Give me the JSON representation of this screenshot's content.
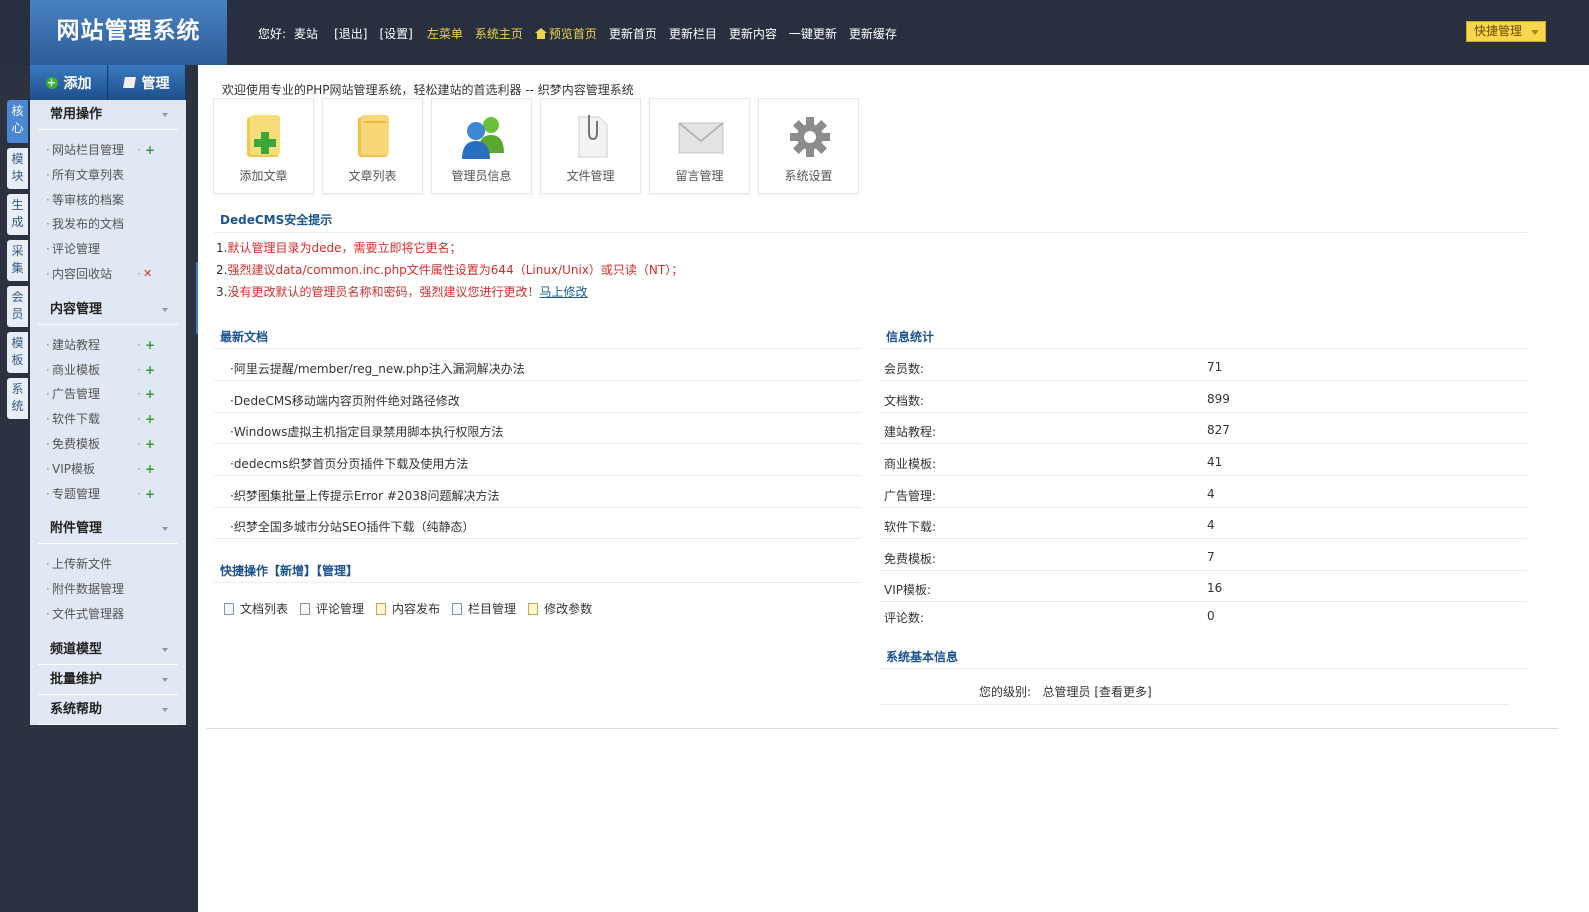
{
  "app": {
    "title": "网站管理系统"
  },
  "topnav": {
    "greeting": "您好:",
    "user": "麦站",
    "logout": "[退出]",
    "settings": "[设置]",
    "left_menu": "左菜单",
    "system_home": "系统主页",
    "preview_home": "预览首页",
    "links": [
      "更新首页",
      "更新栏目",
      "更新内容",
      "一键更新",
      "更新缓存"
    ],
    "quick_manage": "快捷管理"
  },
  "vtabs": [
    "核心",
    "模块",
    "生成",
    "采集",
    "会员",
    "模板",
    "系统"
  ],
  "sidebar": {
    "add_label": "添加",
    "manage_label": "管理",
    "groups": [
      {
        "title": "常用操作",
        "items": [
          "网站栏目管理",
          "所有文章列表",
          "等审核的档案",
          "我发布的文档",
          "评论管理",
          "内容回收站"
        ]
      },
      {
        "title": "内容管理",
        "items": [
          "建站教程",
          "商业模板",
          "广告管理",
          "软件下载",
          "免费模板",
          "VIP模板",
          "专题管理"
        ]
      },
      {
        "title": "附件管理",
        "items": [
          "上传新文件",
          "附件数据管理",
          "文件式管理器"
        ]
      },
      {
        "title": "频道模型",
        "items": []
      },
      {
        "title": "批量维护",
        "items": []
      },
      {
        "title": "系统帮助",
        "items": []
      }
    ]
  },
  "main": {
    "welcome": "欢迎使用专业的PHP网站管理系统，轻松建站的首选利器 -- 织梦内容管理系统",
    "tiles": [
      "添加文章",
      "文章列表",
      "管理员信息",
      "文件管理",
      "留言管理",
      "系统设置"
    ],
    "security": {
      "title": "DedeCMS安全提示",
      "lines": [
        {
          "num": "1.",
          "text": "默认管理目录为dede，需要立即将它更名；"
        },
        {
          "num": "2.",
          "text": "强烈建议data/common.inc.php文件属性设置为644（Linux/Unix）或只读（NT）；"
        },
        {
          "num": "3.",
          "text": "没有更改默认的管理员名称和密码，强烈建议您进行更改！",
          "link": "马上修改"
        }
      ]
    },
    "latest_docs": {
      "title": "最新文档",
      "items": [
        "·阿里云提醒/member/reg_new.php注入漏洞解决办法",
        "·DedeCMS移动端内容页附件绝对路径修改",
        "·Windows虚拟主机指定目录禁用脚本执行权限方法",
        "·dedecms织梦首页分页插件下载及使用方法",
        "·织梦图集批量上传提示Error #2038问题解决方法",
        "·织梦全国多城市分站SEO插件下载（纯静态）"
      ]
    },
    "stats": {
      "title": "信息统计",
      "rows": [
        {
          "k": "会员数:",
          "v": "71"
        },
        {
          "k": "文档数:",
          "v": "899"
        },
        {
          "k": "建站教程:",
          "v": "827"
        },
        {
          "k": "商业模板:",
          "v": "41"
        },
        {
          "k": "广告管理:",
          "v": "4"
        },
        {
          "k": "软件下载:",
          "v": "4"
        },
        {
          "k": "免费模板:",
          "v": "7"
        },
        {
          "k": "VIP模板:",
          "v": "16"
        },
        {
          "k": "评论数:",
          "v": "0"
        }
      ]
    },
    "quick_ops": {
      "title": "快捷操作",
      "new_label": "【新增】",
      "manage_label": "【管理】",
      "items": [
        "文档列表",
        "评论管理",
        "内容发布",
        "栏目管理",
        "修改参数"
      ]
    },
    "sysinfo": {
      "title": "系统基本信息",
      "level_label": "您的级别:",
      "level_value": "总管理员",
      "more": "[查看更多]"
    }
  }
}
